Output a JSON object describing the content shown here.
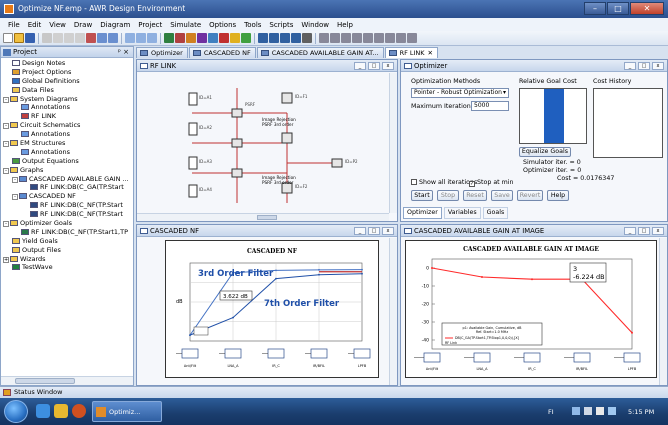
{
  "window": {
    "title": "Optimize NF.emp - AWR Design Environment",
    "buttons": [
      "–",
      "□",
      "✕"
    ]
  },
  "menu": [
    "File",
    "Edit",
    "View",
    "Draw",
    "Diagram",
    "Project",
    "Simulate",
    "Options",
    "Tools",
    "Scripts",
    "Window",
    "Help"
  ],
  "project_panel": {
    "title": "Project",
    "pin": "ᵖ ×",
    "items": [
      {
        "label": "Design Notes",
        "indent": 1,
        "icon": "notes-icon"
      },
      {
        "label": "Project Options",
        "indent": 1,
        "icon": "options-icon"
      },
      {
        "label": "Global Definitions",
        "indent": 1,
        "icon": "definitions-icon"
      },
      {
        "label": "Data Files",
        "indent": 1,
        "icon": "folder-icon"
      },
      {
        "label": "System Diagrams",
        "indent": 1,
        "icon": "folder-icon",
        "expander": "-"
      },
      {
        "label": "Annotations",
        "indent": 2,
        "icon": "annotation-icon"
      },
      {
        "label": "RF LINK",
        "indent": 2,
        "icon": "diagram-icon"
      },
      {
        "label": "Circuit Schematics",
        "indent": 1,
        "icon": "folder-icon",
        "expander": "-"
      },
      {
        "label": "Annotations",
        "indent": 2,
        "icon": "annotation-icon"
      },
      {
        "label": "EM Structures",
        "indent": 1,
        "icon": "folder-icon",
        "expander": "-"
      },
      {
        "label": "Annotations",
        "indent": 2,
        "icon": "annotation-icon"
      },
      {
        "label": "Output Equations",
        "indent": 1,
        "icon": "equation-icon"
      },
      {
        "label": "Graphs",
        "indent": 1,
        "icon": "folder-icon",
        "expander": "-"
      },
      {
        "label": "CASCADED AVAILABLE GAIN ...",
        "indent": 2,
        "icon": "graph-icon",
        "expander": "-"
      },
      {
        "label": "RF LINK:DB(C_GA(TP.Start",
        "indent": 3,
        "icon": "measurement-icon"
      },
      {
        "label": "CASCADED NF",
        "indent": 2,
        "icon": "graph-icon",
        "expander": "-"
      },
      {
        "label": "RF LINK:DB(C_NF(TP.Start",
        "indent": 3,
        "icon": "measurement-icon"
      },
      {
        "label": "RF LINK:DB(C_NF(TP.Start",
        "indent": 3,
        "icon": "measurement-icon"
      },
      {
        "label": "Optimizer Goals",
        "indent": 1,
        "icon": "folder-icon",
        "expander": "-"
      },
      {
        "label": "RF LINK:DB(C_NF(TP.Start1,TP",
        "indent": 2,
        "icon": "goal-icon"
      },
      {
        "label": "Yield Goals",
        "indent": 1,
        "icon": "folder-icon"
      },
      {
        "label": "Output Files",
        "indent": 1,
        "icon": "folder-icon"
      },
      {
        "label": "Wizards",
        "indent": 1,
        "icon": "folder-icon",
        "expander": "+"
      },
      {
        "label": "TestWave",
        "indent": 1,
        "icon": "wave-icon"
      }
    ]
  },
  "tabs": [
    {
      "label": "Optimizer",
      "active": false
    },
    {
      "label": "CASCADED NF",
      "active": false
    },
    {
      "label": "CASCADED AVAILABLE GAIN AT...",
      "active": false
    },
    {
      "label": "RF LINK",
      "active": true,
      "close": "✕"
    }
  ],
  "rf_link_pane": {
    "title": "RF LINK",
    "schematic_labels": [
      "Image Rejection",
      "PSRF 3rd order",
      "Image Rejection",
      "PSRF 3rd order"
    ]
  },
  "optimizer": {
    "title": "Optimizer",
    "methods_label": "Optimization Methods",
    "method_value": "Pointer - Robust Optimization",
    "max_iter_label": "Maximum Iterations",
    "max_iter_value": "5000",
    "relative_goal_cost": "Relative Goal Cost",
    "cost_history": "Cost History",
    "equalize_goals": "Equalize Goals",
    "sim_iter": "Simulator iter. = 0",
    "opt_iter": "Optimizer iter. = 0",
    "cost": "Cost = 0.0176347",
    "show_all_iterations": "Show all iterations",
    "stop_at_min": "Stop at min",
    "buttons": [
      "Start",
      "Stop",
      "Reset",
      "Save",
      "Revert",
      "Help"
    ],
    "subtabs": [
      "Optimizer",
      "Variables",
      "Goals"
    ],
    "relative_goal_cost_fraction": 1.0
  },
  "nf_pane": {
    "title": "CASCADED NF",
    "chart_title": "CASCADED NF",
    "annotation_3rd": "3rd Order Filter",
    "annotation_7th": "7th Order Filter",
    "marker_value": "3.622 dB",
    "ylabel": "dB",
    "block_labels": [
      "Ant/Filt",
      "LNA_A",
      "IR_C",
      "IR/BFIL",
      "LPFB"
    ]
  },
  "gain_pane": {
    "title": "CASCADED AVAILABLE GAIN AT IMAGE",
    "chart_title": "CASCADED AVAILABLE GAIN AT IMAGE",
    "marker_line1": "3",
    "marker_line2": "-6.224 dB",
    "legend_line1": "p1: Available Gain, Cumulative, dB",
    "legend_line2": "Ref. Start=1.0 MHz",
    "legend_series": "DB(C_GA(TP.Start1,TP.Stop1,0,0,0)),[X]",
    "legend_series2": "RF Link",
    "ytick_labels": [
      "0",
      "-10",
      "-20",
      "-30",
      "-40"
    ],
    "block_labels": [
      "Ant/Filt",
      "LNA_A",
      "IR_C",
      "IR/BFIL",
      "LPFB"
    ]
  },
  "chart_data": [
    {
      "type": "line",
      "title": "CASCADED NF",
      "xlabel": "",
      "ylabel": "dB",
      "x": [
        1,
        2,
        3,
        4,
        5
      ],
      "series": [
        {
          "name": "3rd Order Filter",
          "values": [
            0.3,
            3.5,
            3.62,
            3.65,
            3.66
          ]
        },
        {
          "name": "7th Order Filter",
          "values": [
            0.3,
            1.2,
            3.2,
            3.4,
            3.45
          ]
        }
      ],
      "ylim": [
        0,
        4
      ],
      "grid": true
    },
    {
      "type": "line",
      "title": "CASCADED AVAILABLE GAIN AT IMAGE",
      "xlabel": "",
      "ylabel": "",
      "x": [
        1,
        2,
        3,
        4,
        5
      ],
      "series": [
        {
          "name": "RF Link",
          "values": [
            0,
            -5,
            -6.224,
            -6.2,
            -36
          ]
        }
      ],
      "ylim": [
        -45,
        5
      ],
      "grid": false
    }
  ],
  "statusbar": {
    "label": "Status Window"
  },
  "taskbar": {
    "item": "Optimiz...",
    "time": "5:15 PM",
    "tray_text": "FI"
  },
  "colors": {
    "accent": "#2f5fa2",
    "gain_line": "#ff2a2a",
    "nf_line": "#4472c4",
    "goal_bar": "#1f5fbf"
  }
}
